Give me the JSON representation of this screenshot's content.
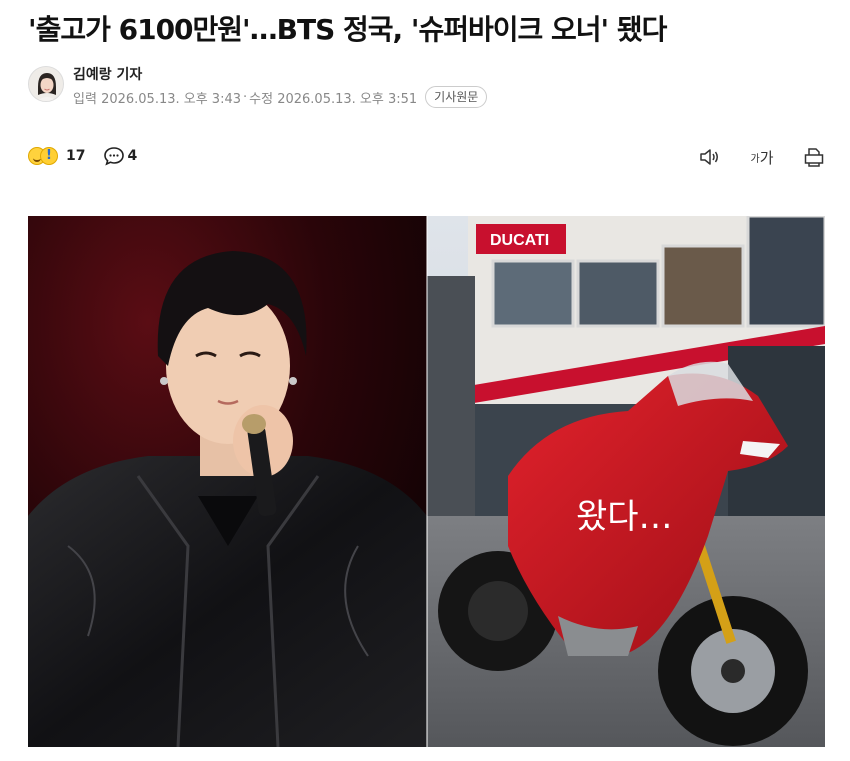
{
  "article": {
    "headline": "'출고가 6100만원'…BTS 정국, '슈퍼바이크 오너' 됐다",
    "reporter": "김예랑 기자",
    "input_label": "입력",
    "input_time": "2026.05.13. 오후 3:43",
    "separator": "·",
    "edit_label": "수정",
    "edit_time": "2026.05.13. 오후 3:51",
    "original_button": "기사원문"
  },
  "actions": {
    "reaction_count": "17",
    "comment_count": "4",
    "font_size_small": "가",
    "font_size_large": "가"
  },
  "photo": {
    "store_sign": "DUCATI",
    "caption_overlay": "왔다…"
  },
  "colors": {
    "ducati_red": "#c8102e",
    "text": "#111111",
    "meta": "#888888"
  }
}
